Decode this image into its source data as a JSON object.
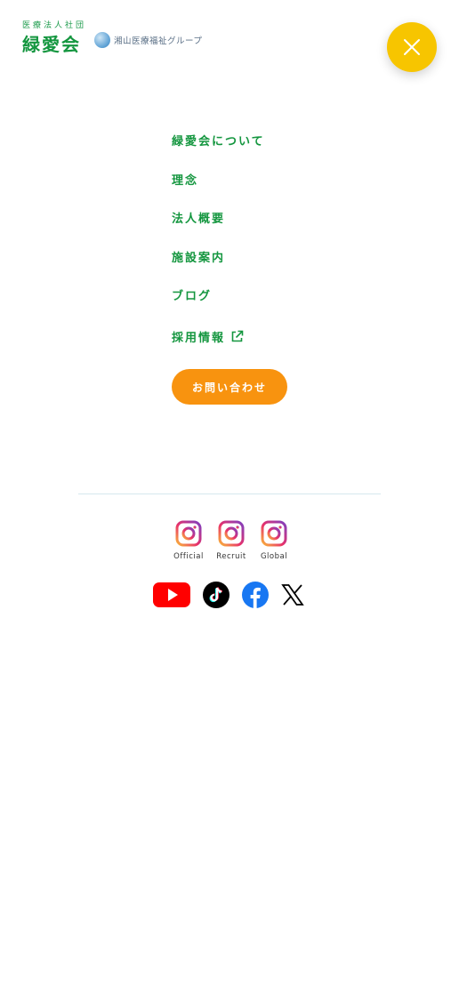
{
  "header": {
    "logo_sub": "医療法人社団",
    "logo_main": "緑愛会",
    "group_name": "湘山医療福祉グループ"
  },
  "menu": {
    "items": [
      {
        "label": "緑愛会について"
      },
      {
        "label": "理念"
      },
      {
        "label": "法人概要"
      },
      {
        "label": "施設案内"
      },
      {
        "label": "ブログ"
      },
      {
        "label": "採用情報"
      }
    ]
  },
  "contact": {
    "label": "お問い合わせ"
  },
  "instagram": [
    {
      "label": "Official"
    },
    {
      "label": "Recruit"
    },
    {
      "label": "Global"
    }
  ],
  "sns": [
    "youtube-icon",
    "tiktok-icon",
    "facebook-icon",
    "x-icon"
  ],
  "colors": {
    "brand_green": "#14963f",
    "close_yellow": "#f7c500",
    "contact_orange": "#f8930f"
  }
}
